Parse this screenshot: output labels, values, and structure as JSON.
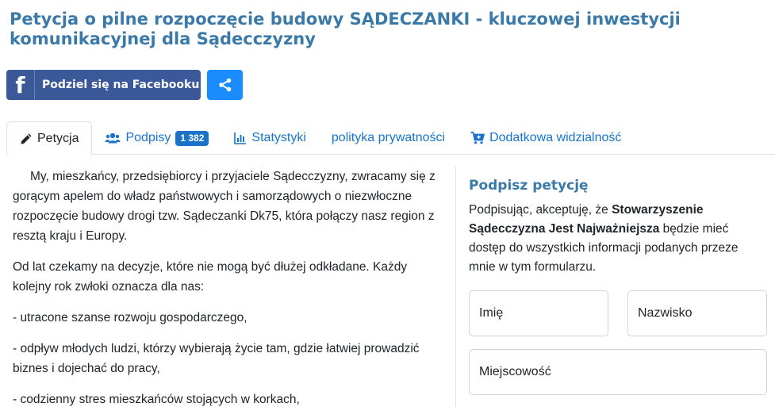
{
  "page": {
    "title": "Petycja o pilne rozpoczęcie budowy SĄDECZANKI - kluczowej inwestycji komunikacyjnej dla Sądecczyzny"
  },
  "share": {
    "facebook_label": "Podziel się na Facebooku",
    "facebook_logo": "f",
    "share_icon": "share-icon"
  },
  "tabs": [
    {
      "label": "Petycja",
      "icon": "pencil-icon"
    },
    {
      "label": "Podpisy",
      "icon": "users-icon",
      "badge": "1 382"
    },
    {
      "label": "Statystyki",
      "icon": "bar-chart-icon"
    },
    {
      "label": "polityka prywatności"
    },
    {
      "label": "Dodatkowa widzialność",
      "icon": "cart-icon"
    }
  ],
  "content": {
    "paragraphs": [
      "My, mieszkańcy, przedsiębiorcy i przyjaciele Sądecczyzny, zwracamy się z gorącym apelem do władz państwowych i samorządowych o niezwłoczne rozpoczęcie budowy drogi tzw. Sądeczanki Dk75, która połączy nasz region z resztą kraju i Europy.",
      "Od lat czekamy na decyzje, które nie mogą być dłużej odkładane. Każdy kolejny rok zwłoki oznacza dla nas:",
      "- utracone szanse rozwoju gospodarczego,",
      "- odpływ młodych ludzi, którzy wybierają życie tam, gdzie łatwiej prowadzić biznes i dojechać do pracy,",
      "- codzienny stres mieszkańców stojących w korkach,"
    ]
  },
  "sidebar": {
    "title": "Podpisz petycję",
    "text_before": "Podpisując, akceptuję, że ",
    "text_bold": "Stowarzyszenie Sądecczyzna Jest Najważniejsza",
    "text_after": " będzie mieć dostęp do wszystkich informacji podanych przeze mnie w tym formularzu.",
    "first_name_placeholder": "Imię",
    "last_name_placeholder": "Nazwisko",
    "city_placeholder": "Miejscowość"
  }
}
